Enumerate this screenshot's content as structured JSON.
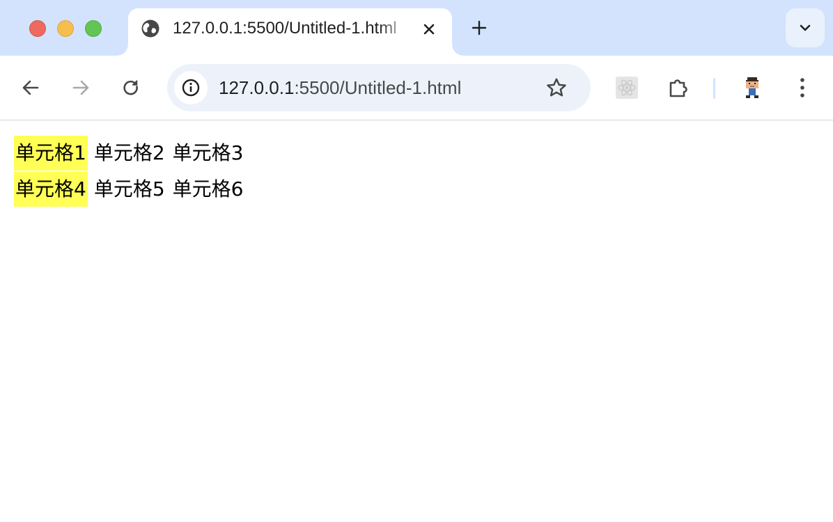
{
  "window": {
    "controls": [
      "close",
      "minimize",
      "maximize"
    ]
  },
  "tab": {
    "title": "127.0.0.1:5500/Untitled-1.html",
    "favicon": "globe-icon"
  },
  "toolbar": {
    "url_host": "127.0.0.1",
    "url_rest": ":5500/Untitled-1.html"
  },
  "colors": {
    "tabstrip": "#d3e3fd",
    "highlight": "#ffff55",
    "omnibox": "#edf2fa"
  },
  "table": {
    "rows": [
      {
        "cells": [
          {
            "text": "单元格1",
            "highlighted": true
          },
          {
            "text": "单元格2",
            "highlighted": false
          },
          {
            "text": "单元格3",
            "highlighted": false
          }
        ]
      },
      {
        "cells": [
          {
            "text": "单元格4",
            "highlighted": true
          },
          {
            "text": "单元格5",
            "highlighted": false
          },
          {
            "text": "单元格6",
            "highlighted": false
          }
        ]
      }
    ]
  }
}
